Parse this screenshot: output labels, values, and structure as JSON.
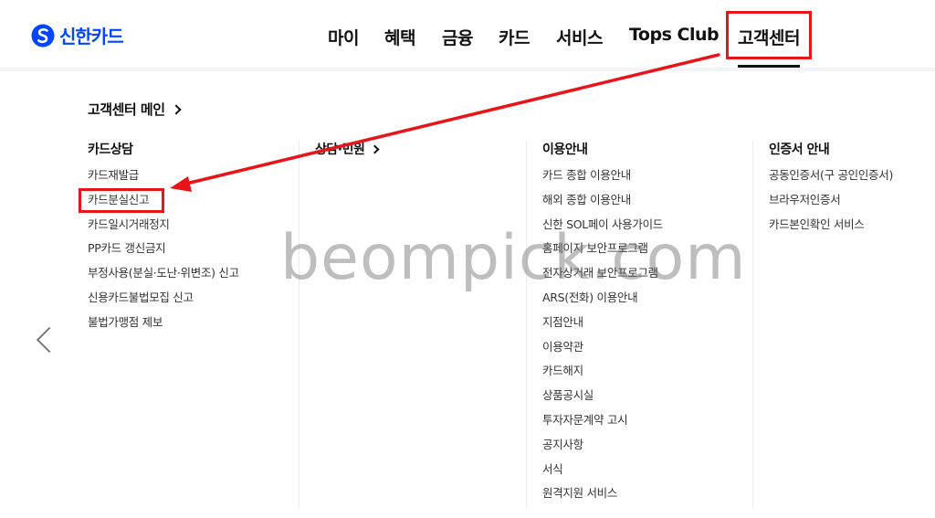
{
  "brand": {
    "name": "신한카드",
    "color": "#0046ff"
  },
  "nav": {
    "items": [
      "마이",
      "혜택",
      "금융",
      "카드",
      "서비스",
      "Tops Club",
      "고객센터"
    ],
    "active": "고객센터"
  },
  "menu": {
    "main_link": "고객센터 메인",
    "columns": [
      {
        "title": "카드상담",
        "items": [
          "카드재발급",
          "카드분실신고",
          "카드일시거래정지",
          "PP카드 갱신금지",
          "부정사용(분실·도난·위변조) 신고",
          "신용카드불법모집 신고",
          "불법가맹점 제보"
        ]
      },
      {
        "title": "상담·민원",
        "items": []
      },
      {
        "title": "이용안내",
        "items": [
          "카드 종합 이용안내",
          "해외 종합 이용안내",
          "신한 SOL페이 사용가이드",
          "홈페이지 보안프로그램",
          "전자상거래 보안프로그램",
          "ARS(전화) 이용안내",
          "지점안내",
          "이용약관",
          "카드해지",
          "상품공시실",
          "투자자문계약 고시",
          "공지사항",
          "서식",
          "원격지원 서비스"
        ]
      },
      {
        "title": "인증서 안내",
        "items": [
          "공동인증서(구 공인인증서)",
          "브라우저인증서",
          "카드본인확인 서비스"
        ]
      }
    ]
  },
  "annotation": {
    "color": "#e8141a"
  },
  "watermark": "beompick.com"
}
